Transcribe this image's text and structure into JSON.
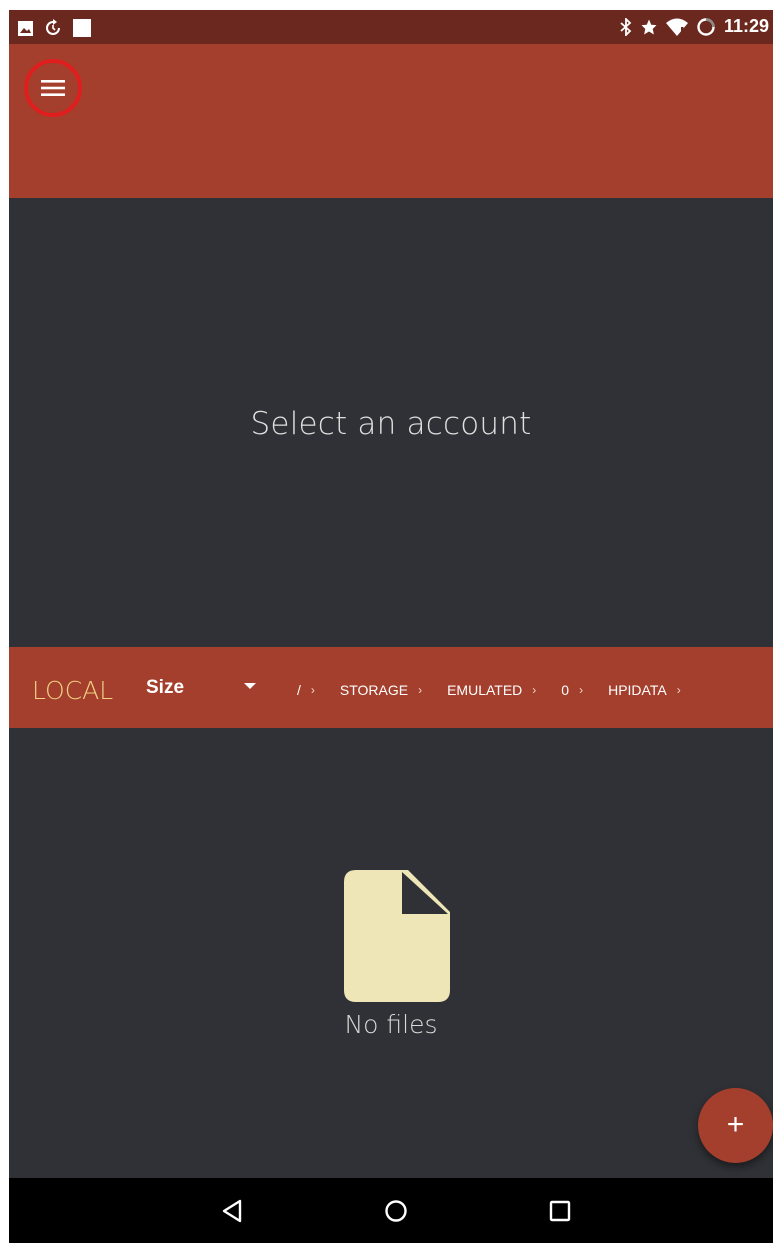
{
  "status_bar": {
    "time": "11:29",
    "left_icons": [
      "image-notification-icon",
      "sync-icon",
      "square-notification-icon"
    ],
    "right_icons": [
      "bluetooth-icon",
      "star-icon",
      "wifi-icon",
      "battery-icon"
    ]
  },
  "toolbar": {
    "menu_icon": "hamburger-menu-icon"
  },
  "account": {
    "prompt": "Select an account"
  },
  "local_bar": {
    "title": "LOCAL",
    "sort_label": "Size",
    "breadcrumbs": [
      {
        "label": "/"
      },
      {
        "label": "STORAGE"
      },
      {
        "label": "EMULATED"
      },
      {
        "label": "0"
      },
      {
        "label": "HPIDATA"
      }
    ],
    "separator": "›"
  },
  "files": {
    "empty_message": "No files",
    "empty_icon": "file-icon"
  },
  "fab": {
    "label": "+"
  },
  "nav_bar": {
    "buttons": [
      "back-icon",
      "home-icon",
      "recents-icon"
    ]
  },
  "colors": {
    "primary": "#a33f2c",
    "status_bar": "#6b281e",
    "background": "#2f3136",
    "accent_text": "#f1d080",
    "file_icon": "#efe6b8",
    "highlight_ring": "#e01e1e"
  }
}
